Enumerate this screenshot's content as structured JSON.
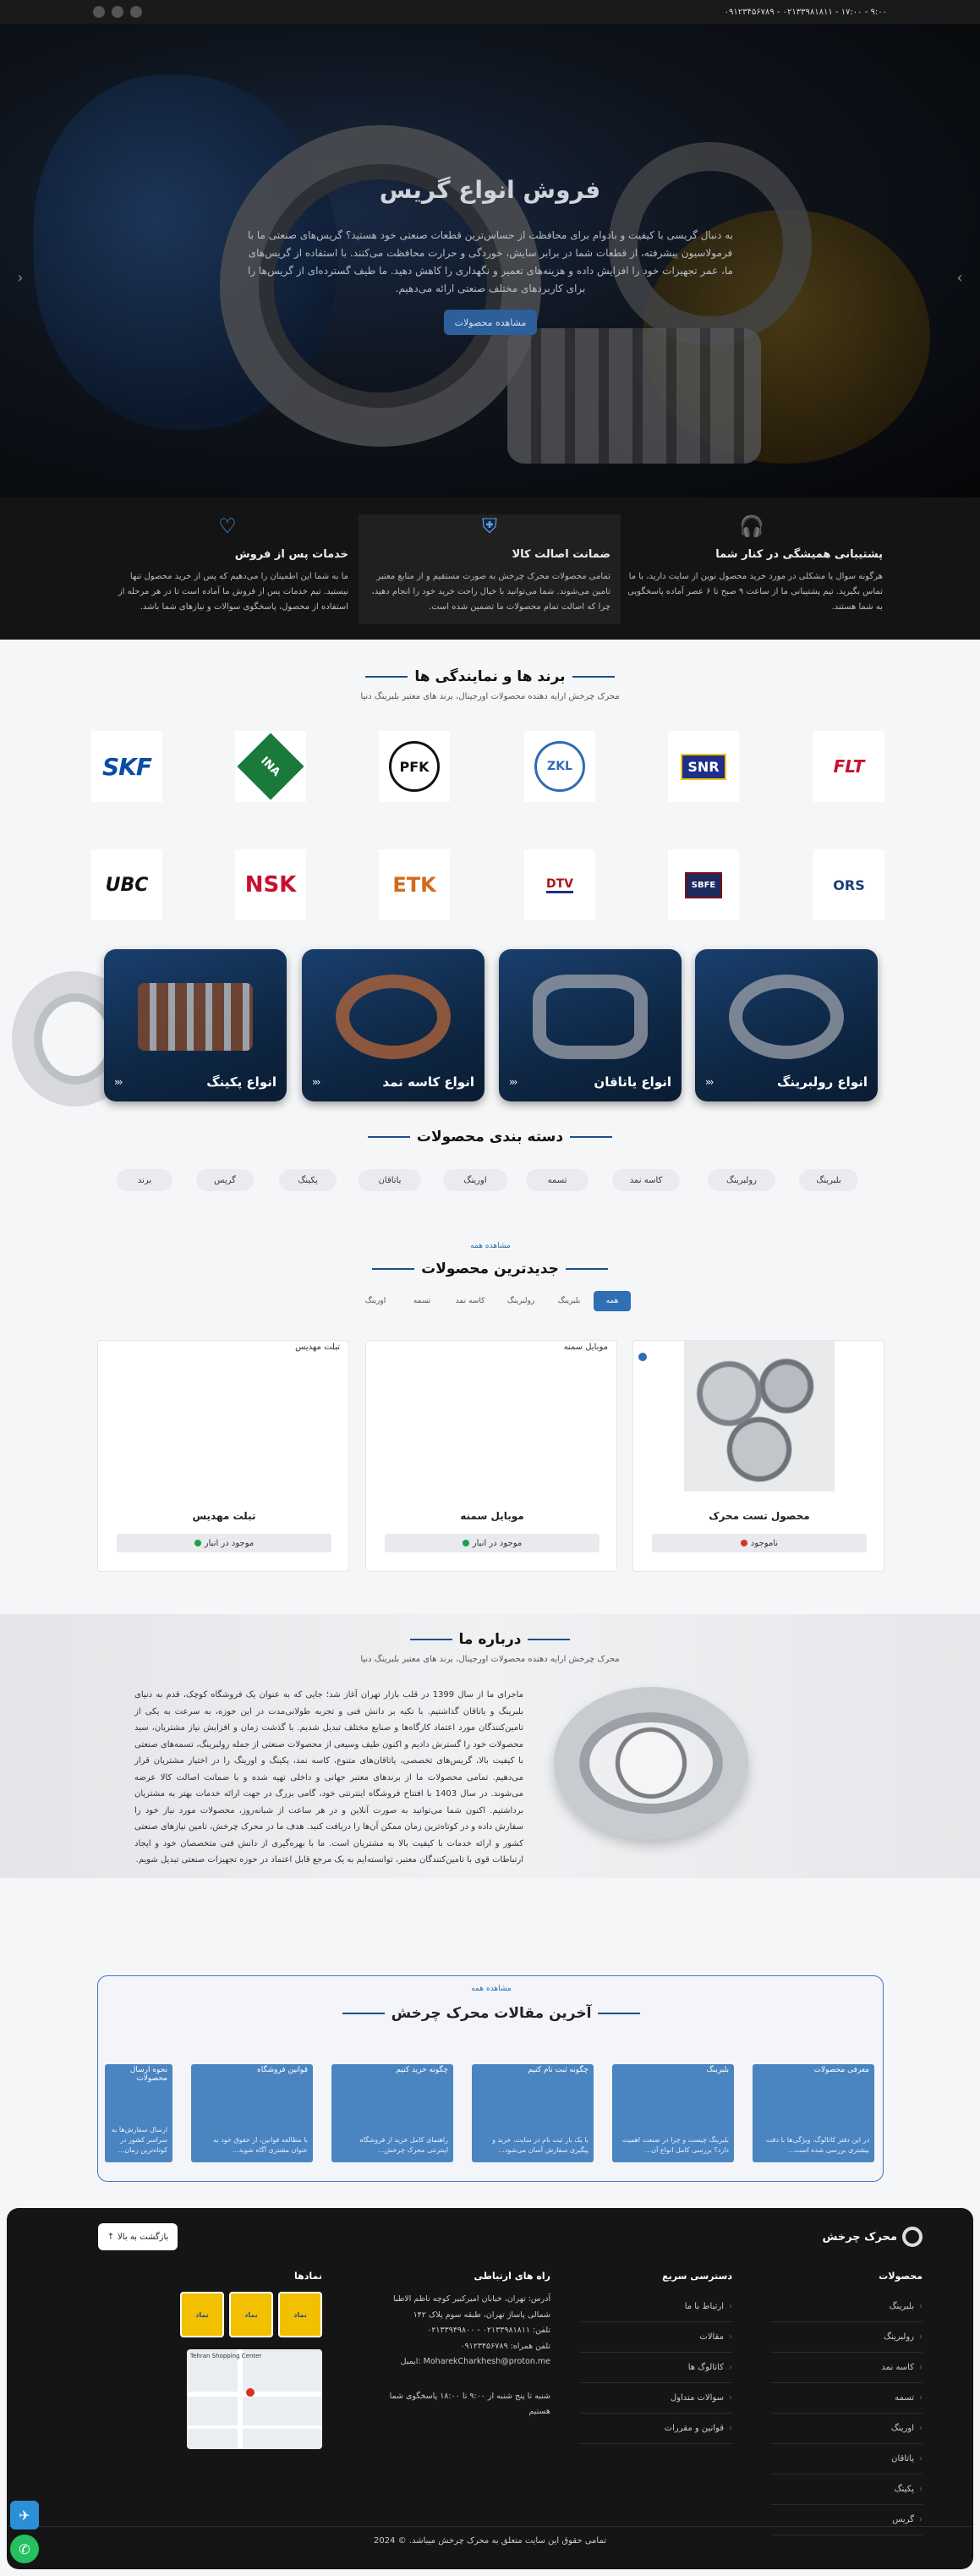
{
  "topbar": {
    "phones": "۰۹۱۲۳۴۵۶۷۸۹ - ۰۲۱۳۳۹۸۱۸۱۱ - ۱۷:۰۰ - ۹:۰۰",
    "social_icons": [
      "whatsapp-icon",
      "telegram-icon",
      "instagram-icon"
    ]
  },
  "hero": {
    "title": "فروش انواع گریس",
    "text": "به دنبال گریسی با کیفیت و بادوام برای محافظت از حساس‌ترین قطعات صنعتی خود هستید؟ گریس‌های صنعتی ما با فرمولاسیون پیشرفته، از قطعات شما در برابر سایش، خوردگی و حرارت محافظت می‌کنند. با استفاده از گریس‌های ما، عمر تجهیزات خود را افزایش داده و هزینه‌های تعمیر و نگهداری را کاهش دهید. ما طیف گسترده‌ای از گریس‌ها را برای کاربردهای مختلف صنعتی ارائه می‌دهیم.",
    "cta": "مشاهده محصولات",
    "prev": "‹",
    "next": "›"
  },
  "features": [
    {
      "icon": "headset-icon",
      "title": "پشتیبانی همیشگی در کنار شما",
      "text": "هرگونه سوال یا مشکلی در مورد خرید محصول نوین از سایت دارید، با ما تماس بگیرید. تیم پشتیبانی ما از ساعت ۹ صبح تا ۶ عصر آماده پاسخگویی به شما هستند."
    },
    {
      "icon": "shield-icon",
      "title": "ضمانت اصالت کالا",
      "text": "تمامی محصولات محرک چرخش به صورت مستقیم و از منابع معتبر تامین می‌شوند. شما می‌توانید با خیال راحت خرید خود را انجام دهید، چرا که اصالت تمام محصولات ما تضمین شده است."
    },
    {
      "icon": "heart-hand-icon",
      "title": "خدمات پس از فروش",
      "text": "ما به شما این اطمینان را می‌دهیم که پس از خرید محصول تنها نیستید. تیم خدمات پس از فروش ما آماده است تا در هر مرحله از استفاده از محصول، پاسخگوی سوالات و نیازهای شما باشد."
    }
  ],
  "brands": {
    "title": "برند ها و نمایندگی ها",
    "subtitle": "محرک چرخش ارایه دهنده محصولات اورجینال، برند های معتبر بلبرینگ دنیا",
    "row1": [
      {
        "label": "FLT",
        "color": "#c8102e"
      },
      {
        "label": "SNR",
        "color": "#1e2f8a"
      },
      {
        "label": "ZKL",
        "color": "#2e6bb5"
      },
      {
        "label": "PFK",
        "color": "#111111"
      },
      {
        "label": "INA",
        "color": "#1a7a3c"
      },
      {
        "label": "SKF",
        "color": "#0a4ca6"
      }
    ],
    "row2": [
      {
        "label": "ORS",
        "color": "#1d3b7a"
      },
      {
        "label": "SBFE",
        "color": "#7a1010"
      },
      {
        "label": "DTV",
        "color": "#b0121b"
      },
      {
        "label": "ETK",
        "color": "#d46a1a"
      },
      {
        "label": "NSK",
        "color": "#c8102e"
      },
      {
        "label": "UBC",
        "color": "#111111"
      }
    ]
  },
  "categories_cards": [
    {
      "label": "انواع رولبرینگ"
    },
    {
      "label": "انواع یاتاقان"
    },
    {
      "label": "انواع کاسه نمد"
    },
    {
      "label": "انواع پکینگ"
    }
  ],
  "category_section": {
    "title": "دسته بندی محصولات",
    "pills": [
      "بلبرینگ",
      "رولبرینگ",
      "کاسه نمد",
      "تسمه",
      "اورینگ",
      "یاتاقان",
      "پکینگ",
      "گریس",
      "برند"
    ]
  },
  "latest": {
    "see_all": "مشاهده همه",
    "title": "جدیدترین محصولات",
    "tabs": [
      "همه",
      "بلبرینگ",
      "رولبرینگ",
      "کاسه نمد",
      "تسمه",
      "اورینگ"
    ],
    "products": [
      {
        "caption": "",
        "name": "محصول تست محرک",
        "stock": "ناموجود",
        "stock_color": "#d93025"
      },
      {
        "caption": "موبایل سمنه",
        "name": "موبایل سمنه",
        "stock": "موجود در انبار",
        "stock_color": "#1e9e4a"
      },
      {
        "caption": "تبلت مهدیس",
        "name": "تبلت مهدیس",
        "stock": "موجود در انبار",
        "stock_color": "#1e9e4a"
      }
    ]
  },
  "about": {
    "title": "درباره ما",
    "subtitle": "محرک چرخش ارایه دهنده محصولات اورجینال، برند های معتبر بلبرینگ دنیا",
    "text": "ماجرای ما از سال 1399 در قلب بازار تهران آغاز شد؛ جایی که به عنوان یک فروشگاه کوچک، قدم به دنیای بلبرینگ و یاتاقان گذاشتیم. با تکیه بر دانش فنی و تجربه طولانی‌مدت در این حوزه، به سرعت به یکی از تامین‌کنندگان مورد اعتماد کارگاه‌ها و صنایع مختلف تبدیل شدیم. با گذشت زمان و افزایش نیاز مشتریان، سبد محصولات خود را گسترش دادیم و اکنون طیف وسیعی از محصولات صنعتی از جمله رولبرینگ، تسمه‌های صنعتی با کیفیت بالا، گریس‌های تخصصی، یاتاقان‌های متنوع، کاسه نمد، پکینگ و اورینگ را در اختیار مشتریان قرار می‌دهیم. تمامی محصولات ما از برندهای معتبر جهانی و داخلی تهیه شده و با ضمانت اصالت کالا عرضه می‌شوند. در سال 1403 با افتتاح فروشگاه اینترنتی خود، گامی بزرگ در جهت ارائه خدمات بهتر به مشتریان برداشتیم. اکنون شما می‌توانید به صورت آنلاین و در هر ساعت از شبانه‌روز، محصولات مورد نیاز خود را سفارش داده و در کوتاه‌ترین زمان ممکن آن‌ها را دریافت کنید. هدف ما در محرک چرخش، تامین نیازهای صنعتی کشور و ارائه خدمات با کیفیت بالا به مشتریان است. ما با بهره‌گیری از دانش فنی متخصصان خود و ایجاد ارتباطات قوی با تامین‌کنندگان معتبر، توانسته‌ایم به یک مرجع قابل اعتماد در حوزه تجهیزات صنعتی تبدیل شویم."
  },
  "articles": {
    "see_all": "مشاهده همه",
    "title": "آخرین مقالات محرک چرخش",
    "items": [
      {
        "title": "معرفی محصولات",
        "text": "در این دفتر کاتالوگ، ویژگی‌ها با دقت بیشتری بررسی شده است..."
      },
      {
        "title": "بلبرینگ",
        "text": "بلبرینگ چیست و چرا در صنعت اهمیت دارد؟ بررسی کامل انواع آن..."
      },
      {
        "title": "چگونه ثبت نام کنیم",
        "text": "با یک بار ثبت نام در سایت، خرید و پیگیری سفارش آسان می‌شود..."
      },
      {
        "title": "چگونه خرید کنیم",
        "text": "راهنمای کامل خرید از فروشگاه اینترنتی محرک چرخش..."
      },
      {
        "title": "قوانین فروشگاه",
        "text": "با مطالعه قوانین، از حقوق خود به عنوان مشتری آگاه شوید..."
      },
      {
        "title": "نحوه ارسال محصولات",
        "text": "ارسال سفارش‌ها به سراسر کشور در کوتاه‌ترین زمان..."
      }
    ]
  },
  "footer": {
    "logo": "محرک چرخش",
    "back_to_top": "بازگشت به بالا",
    "products_title": "محصولات",
    "products": [
      "بلبرینگ",
      "رولبرینگ",
      "کاسه نمد",
      "تسمه",
      "اورینگ",
      "یاتاقان",
      "پکینگ",
      "گریس"
    ],
    "quick_title": "دسترسی سریع",
    "quick": [
      "ارتباط با ما",
      "مقالات",
      "کاتالوگ ها",
      "سوالات متداول",
      "قوانین و مقررات"
    ],
    "contact_title": "راه های ارتباطی",
    "address": "آدرس: تهران، خیابان امیرکبیر کوچه ناظم الاطبا شمالی پاساژ تهران، طبقه سوم پلاک ۱۴۲",
    "phone": "تلفن: ۰۲۱۳۳۹۸۱۸۱۱ - ۰۲۱۳۳۹۴۹۸۰۰",
    "mobile": "تلفن همراه: ۰۹۱۲۳۴۵۶۷۸۹",
    "email": "ایمیل: MoharekCharkhesh@proton.me",
    "hours": "شنبه تا پنج شنبه از ۹:۰۰ تا ۱۸:۰۰ پاسخگوی شما هستیم",
    "badges_title": "نمادها",
    "badges": [
      "نماد",
      "نماد",
      "نماد"
    ],
    "map_label": "Tehran Shopping Center",
    "copyright": "تمامی حقوق این سایت متعلق به محرک چرخش میباشد. © 2024"
  },
  "float_buttons": [
    "telegram-icon",
    "whatsapp-icon"
  ]
}
